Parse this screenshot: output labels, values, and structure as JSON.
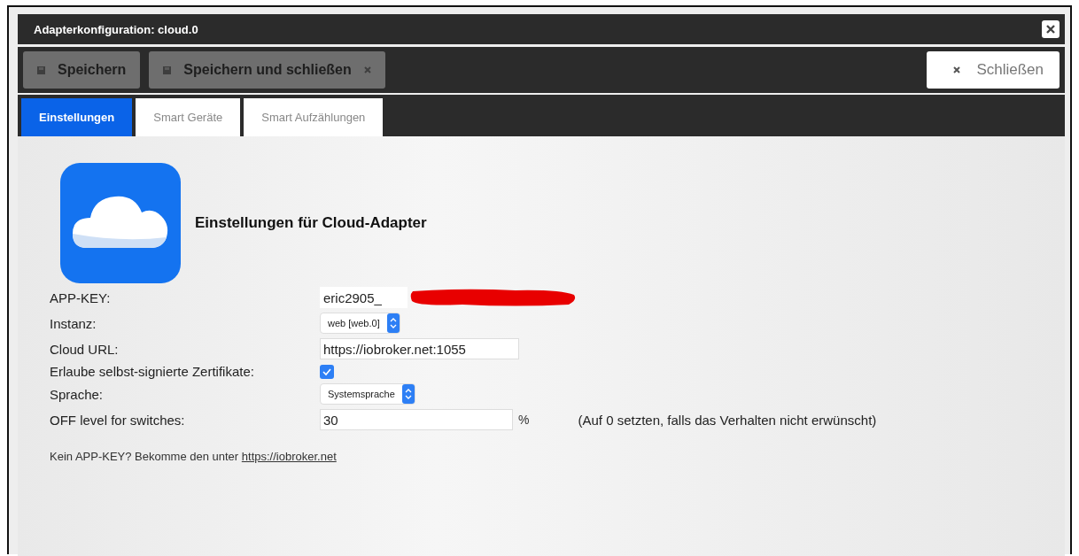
{
  "window": {
    "title": "Adapterkonfiguration: cloud.0"
  },
  "toolbar": {
    "buttons": [
      {
        "label": "Speichern",
        "disabled": true,
        "kind": "save"
      },
      {
        "label": "Speichern und schließen",
        "disabled": true,
        "kind": "save-close"
      }
    ],
    "close_button": {
      "label": "Schließen"
    }
  },
  "tabs": [
    {
      "label": "Einstellungen",
      "selected": true
    },
    {
      "label": "Smart Geräte",
      "selected": false
    },
    {
      "label": "Smart Aufzählungen",
      "selected": false
    }
  ],
  "heading": "Einstellungen für Cloud-Adapter",
  "fields": [
    {
      "kind": "text",
      "label": "APP-KEY:",
      "value": "eric2905_",
      "redacted": true
    },
    {
      "kind": "select",
      "label": "Instanz:",
      "value": "web [web.0]"
    },
    {
      "kind": "text",
      "label": "Cloud URL:",
      "value": "https://iobroker.net:1055"
    },
    {
      "kind": "checkbox",
      "label": "Erlaube selbst-signierte Zertifikate:",
      "checked": true
    },
    {
      "kind": "select",
      "label": "Sprache:",
      "value": "Systemsprache"
    },
    {
      "kind": "number",
      "label": "OFF level for switches:",
      "value": "30",
      "unit": "%",
      "hint": "(Auf 0 setzten, falls das Verhalten nicht erwünscht)"
    }
  ],
  "footer": {
    "text": "Kein APP-KEY? Bekomme den unter",
    "link": "https://iobroker.net"
  }
}
